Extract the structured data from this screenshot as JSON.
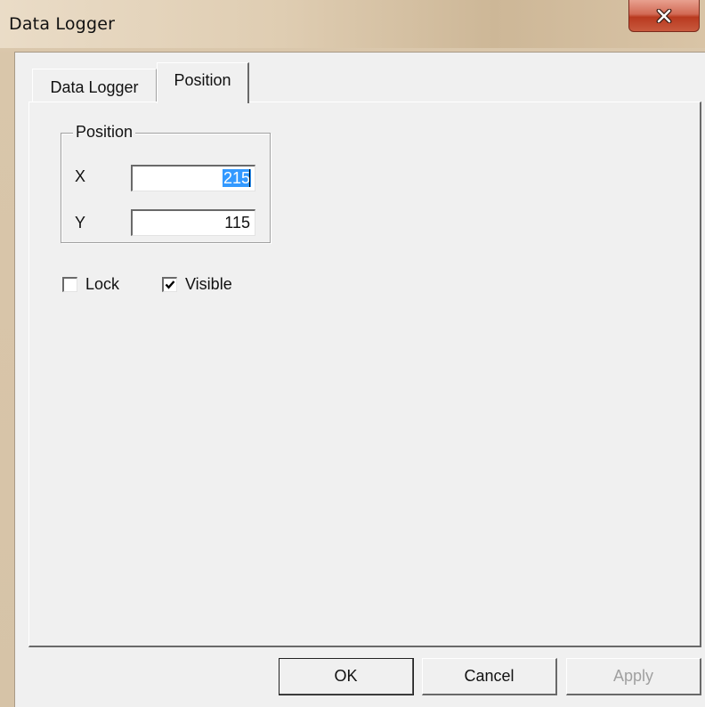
{
  "window": {
    "title": "Data Logger",
    "close_icon": "close-icon"
  },
  "tabs": [
    {
      "label": "Data Logger",
      "active": false
    },
    {
      "label": "Position",
      "active": true
    }
  ],
  "position_group": {
    "legend": "Position",
    "x": {
      "label": "X",
      "value": "215",
      "value_visible": "21",
      "value_tail": "5",
      "selected": true
    },
    "y": {
      "label": "Y",
      "value": "115"
    }
  },
  "options": {
    "lock": {
      "label": "Lock",
      "checked": false
    },
    "visible": {
      "label": "Visible",
      "checked": true
    }
  },
  "buttons": {
    "ok": "OK",
    "cancel": "Cancel",
    "apply": "Apply",
    "apply_enabled": false
  },
  "colors": {
    "selection": "#3399ff",
    "client_bg": "#f0f0f0",
    "close_button": "#c9523a"
  }
}
